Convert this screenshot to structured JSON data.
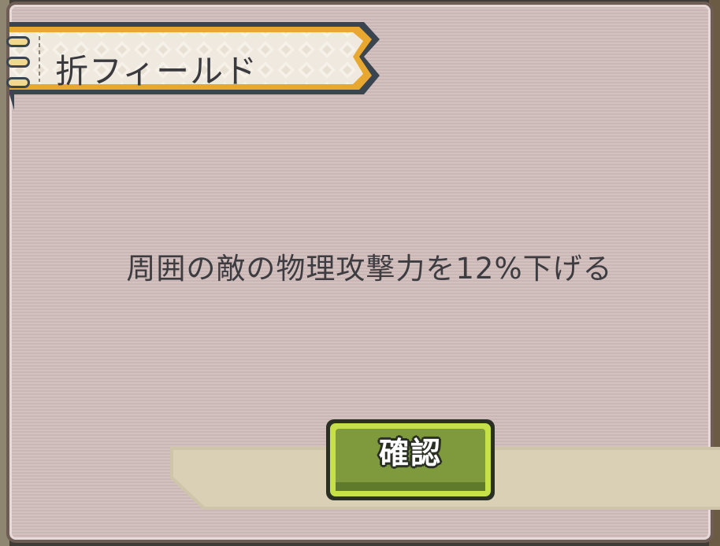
{
  "dialog": {
    "title": "折フィールド",
    "description": "周囲の敵の物理攻撃力を12%下げる",
    "confirm_label": "確認"
  },
  "colors": {
    "panel_background": "#d2bfbe",
    "panel_border": "#6e5d55",
    "banner_fill": "#efe9df",
    "banner_border": "#e8a830",
    "banner_outline": "#3a4550",
    "button_fill": "#7e9a3c",
    "button_border": "#c6e04a",
    "button_outline": "#2a2f24",
    "tray_fill": "#d9d0b6"
  }
}
